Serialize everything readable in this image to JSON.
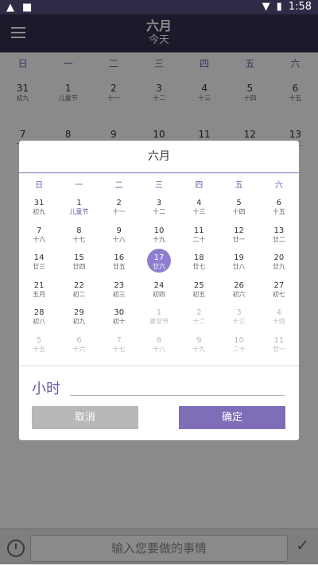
{
  "status_bar": {
    "time": "1:58",
    "left_icons": [
      "notification-icon",
      "save-icon"
    ],
    "right_icons": [
      "wifi-icon",
      "battery-icon"
    ]
  },
  "app_bar": {
    "title": "六月",
    "subtitle": "今天"
  },
  "weekdays": [
    "日",
    "一",
    "二",
    "三",
    "四",
    "五",
    "六"
  ],
  "background_calendar": [
    [
      {
        "n": "31",
        "l": "初九"
      },
      {
        "n": "1",
        "l": "儿童节"
      },
      {
        "n": "2",
        "l": "十一"
      },
      {
        "n": "3",
        "l": "十二"
      },
      {
        "n": "4",
        "l": "十三"
      },
      {
        "n": "5",
        "l": "十四"
      },
      {
        "n": "6",
        "l": "十五"
      }
    ],
    [
      {
        "n": "7",
        "l": "十六"
      },
      {
        "n": "8",
        "l": "十七"
      },
      {
        "n": "9",
        "l": "十八"
      },
      {
        "n": "10",
        "l": "十九"
      },
      {
        "n": "11",
        "l": "二十"
      },
      {
        "n": "12",
        "l": "廿一"
      },
      {
        "n": "13",
        "l": "廿二"
      }
    ]
  ],
  "dialog": {
    "month_title": "六月",
    "weekdays": [
      "日",
      "一",
      "二",
      "三",
      "四",
      "五",
      "六"
    ],
    "rows": [
      [
        {
          "n": "31",
          "l": "初九",
          "state": "normal"
        },
        {
          "n": "1",
          "l": "儿童节",
          "state": "festival"
        },
        {
          "n": "2",
          "l": "十一",
          "state": "normal"
        },
        {
          "n": "3",
          "l": "十二",
          "state": "normal"
        },
        {
          "n": "4",
          "l": "十三",
          "state": "normal"
        },
        {
          "n": "5",
          "l": "十四",
          "state": "normal"
        },
        {
          "n": "6",
          "l": "十五",
          "state": "normal"
        }
      ],
      [
        {
          "n": "7",
          "l": "十六",
          "state": "normal"
        },
        {
          "n": "8",
          "l": "十七",
          "state": "normal"
        },
        {
          "n": "9",
          "l": "十八",
          "state": "normal"
        },
        {
          "n": "10",
          "l": "十九",
          "state": "normal"
        },
        {
          "n": "11",
          "l": "二十",
          "state": "normal"
        },
        {
          "n": "12",
          "l": "廿一",
          "state": "normal"
        },
        {
          "n": "13",
          "l": "廿二",
          "state": "normal"
        }
      ],
      [
        {
          "n": "14",
          "l": "廿三",
          "state": "normal"
        },
        {
          "n": "15",
          "l": "廿四",
          "state": "normal"
        },
        {
          "n": "16",
          "l": "廿五",
          "state": "normal"
        },
        {
          "n": "17",
          "l": "廿六",
          "state": "selected"
        },
        {
          "n": "18",
          "l": "廿七",
          "state": "normal"
        },
        {
          "n": "19",
          "l": "廿八",
          "state": "normal"
        },
        {
          "n": "20",
          "l": "廿九",
          "state": "normal"
        }
      ],
      [
        {
          "n": "21",
          "l": "五月",
          "state": "normal"
        },
        {
          "n": "22",
          "l": "初二",
          "state": "normal"
        },
        {
          "n": "23",
          "l": "初三",
          "state": "normal"
        },
        {
          "n": "24",
          "l": "初四",
          "state": "normal"
        },
        {
          "n": "25",
          "l": "初五",
          "state": "normal"
        },
        {
          "n": "26",
          "l": "初六",
          "state": "normal"
        },
        {
          "n": "27",
          "l": "初七",
          "state": "normal"
        }
      ],
      [
        {
          "n": "28",
          "l": "初八",
          "state": "normal"
        },
        {
          "n": "29",
          "l": "初九",
          "state": "normal"
        },
        {
          "n": "30",
          "l": "初十",
          "state": "normal"
        },
        {
          "n": "1",
          "l": "建党节",
          "state": "out"
        },
        {
          "n": "2",
          "l": "十二",
          "state": "out"
        },
        {
          "n": "3",
          "l": "十三",
          "state": "out"
        },
        {
          "n": "4",
          "l": "十四",
          "state": "out"
        }
      ],
      [
        {
          "n": "5",
          "l": "十五",
          "state": "out"
        },
        {
          "n": "6",
          "l": "十六",
          "state": "out"
        },
        {
          "n": "7",
          "l": "十七",
          "state": "out"
        },
        {
          "n": "8",
          "l": "十八",
          "state": "out"
        },
        {
          "n": "9",
          "l": "十九",
          "state": "out"
        },
        {
          "n": "10",
          "l": "二十",
          "state": "out"
        },
        {
          "n": "11",
          "l": "廿一",
          "state": "out"
        }
      ]
    ],
    "hours_label": "小时",
    "hours_value": "",
    "cancel_label": "取消",
    "confirm_label": "确定"
  },
  "bottom_bar": {
    "input_placeholder": "输入您要做的事情"
  },
  "colors": {
    "accent": "#7f6eb7",
    "selected": "#8f7ed0",
    "header": "#352f50"
  }
}
